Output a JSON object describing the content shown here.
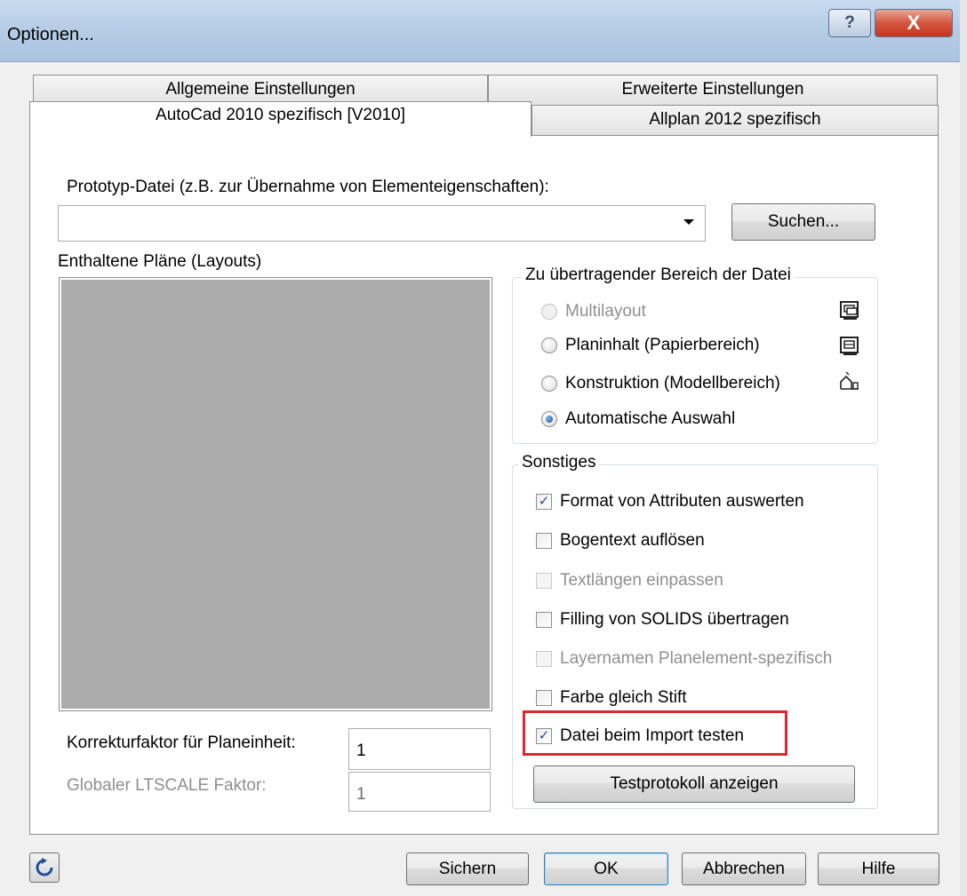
{
  "window": {
    "title": "Optionen...",
    "help_glyph": "?",
    "close_glyph": "X"
  },
  "tabs": [
    {
      "label": "Allgemeine Einstellungen"
    },
    {
      "label": "Erweiterte Einstellungen"
    },
    {
      "label": "AutoCad 2010 spezifisch [V2010]"
    },
    {
      "label": "Allplan 2012 spezifisch"
    }
  ],
  "prototype": {
    "label": "Prototyp-Datei (z.B. zur Übernahme von Elementeigenschaften):",
    "value": "",
    "search_button": "Suchen..."
  },
  "layouts": {
    "label": "Enthaltene Pläne (Layouts)"
  },
  "range_group": {
    "title": "Zu übertragender Bereich der Datei",
    "options": [
      {
        "label": "Multilayout",
        "checked": false,
        "disabled": true,
        "icon": "multilayout-icon"
      },
      {
        "label": "Planinhalt (Papierbereich)",
        "checked": false,
        "disabled": false,
        "icon": "paper-space-icon"
      },
      {
        "label": "Konstruktion (Modellbereich)",
        "checked": false,
        "disabled": false,
        "icon": "model-space-icon"
      },
      {
        "label": "Automatische Auswahl",
        "checked": true,
        "disabled": false
      }
    ]
  },
  "misc_group": {
    "title": "Sonstiges",
    "options": [
      {
        "label": "Format von Attributen auswerten",
        "checked": true,
        "disabled": false
      },
      {
        "label": "Bogentext auflösen",
        "checked": false,
        "disabled": false
      },
      {
        "label": "Textlängen einpassen",
        "checked": false,
        "disabled": true
      },
      {
        "label": "Filling von SOLIDS übertragen",
        "checked": false,
        "disabled": false
      },
      {
        "label": "Layernamen Planelement-spezifisch",
        "checked": false,
        "disabled": true
      },
      {
        "label": "Farbe gleich Stift",
        "checked": false,
        "disabled": false
      },
      {
        "label": "Datei beim Import testen",
        "checked": true,
        "disabled": false
      }
    ],
    "test_log_button": "Testprotokoll anzeigen"
  },
  "factors": {
    "correction_label": "Korrekturfaktor für Planeinheit:",
    "correction_value": "1",
    "ltscale_label": "Globaler LTSCALE Faktor:",
    "ltscale_value": "1"
  },
  "footer": {
    "save": "Sichern",
    "ok": "OK",
    "cancel": "Abbrechen",
    "help": "Hilfe"
  },
  "colors": {
    "highlight": "#e0262d",
    "close_button": "#c2381f",
    "listbox_bg": "#ababab"
  }
}
